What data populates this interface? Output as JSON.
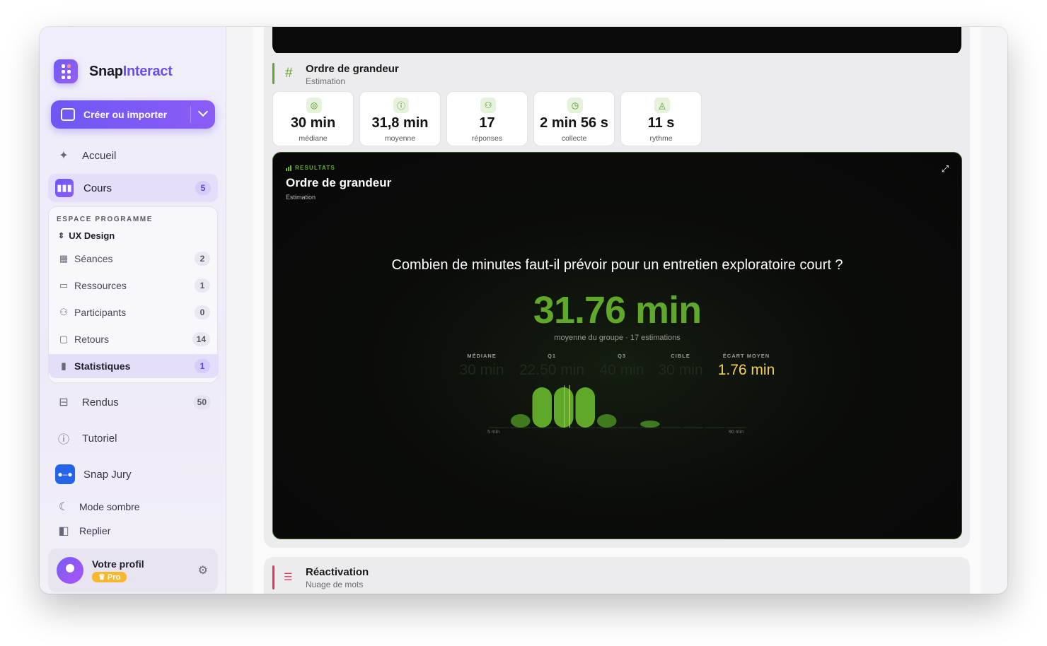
{
  "brand": {
    "name_part1": "Snap",
    "name_part2": "Interact"
  },
  "create_button": {
    "label": "Créer ou importer"
  },
  "nav": {
    "home": "Accueil",
    "courses": {
      "label": "Cours",
      "count": "5"
    },
    "deliverables": {
      "label": "Rendus",
      "count": "50"
    },
    "tutorial": "Tutoriel",
    "jury": "Snap Jury",
    "dark_mode": "Mode sombre",
    "collapse": "Replier"
  },
  "program": {
    "header": "ESPACE PROGRAMME",
    "name": "UX Design",
    "items": [
      {
        "label": "Séances",
        "count": "2",
        "icon": "calendar-icon"
      },
      {
        "label": "Ressources",
        "count": "1",
        "icon": "folder-icon"
      },
      {
        "label": "Participants",
        "count": "0",
        "icon": "users-icon"
      },
      {
        "label": "Retours",
        "count": "14",
        "icon": "chat-icon"
      },
      {
        "label": "Statistiques",
        "count": "1",
        "icon": "bar-chart-icon"
      }
    ]
  },
  "profile": {
    "name": "Votre profil",
    "plan": "Pro"
  },
  "activity": {
    "title": "Ordre de grandeur",
    "type": "Estimation",
    "stats": [
      {
        "value": "30 min",
        "label": "médiane",
        "icon": "target-icon"
      },
      {
        "value": "31,8 min",
        "label": "moyenne",
        "icon": "info-icon"
      },
      {
        "value": "17",
        "label": "réponses",
        "icon": "people-icon"
      },
      {
        "value": "2 min 56 s",
        "label": "collecte",
        "icon": "clock-icon"
      },
      {
        "value": "11 s",
        "label": "rythme",
        "icon": "speed-icon"
      }
    ]
  },
  "results": {
    "tag": "RESULTATS",
    "title": "Ordre de grandeur",
    "subtitle": "Estimation",
    "question": "Combien de minutes faut-il prévoir pour un entretien exploratoire court ?",
    "big_value": "31.76 min",
    "caption": "moyenne du groupe · 17 estimations",
    "metrics": [
      {
        "label": "MÉDIANE",
        "value": "30 min"
      },
      {
        "label": "Q1",
        "value": "22.50 min"
      },
      {
        "label": "Q3",
        "value": "40 min"
      },
      {
        "label": "CIBLE",
        "value": "30 min"
      },
      {
        "label": "ÉCART MOYEN",
        "value": "1.76 min"
      }
    ],
    "colors": {
      "accent": "#5fa82a",
      "highlight": "#f7d154"
    }
  },
  "chart_data": {
    "type": "bar",
    "x_range": [
      5,
      90
    ],
    "x_axis_labels": [
      "5 min",
      "90 min"
    ],
    "bins": 12,
    "values": [
      0,
      1,
      3,
      3,
      3,
      1,
      0,
      0.4,
      0,
      0,
      0,
      0
    ],
    "markers": {
      "mean": 31.76,
      "median": 30
    }
  },
  "next_activity": {
    "title": "Réactivation",
    "type": "Nuage de mots"
  }
}
